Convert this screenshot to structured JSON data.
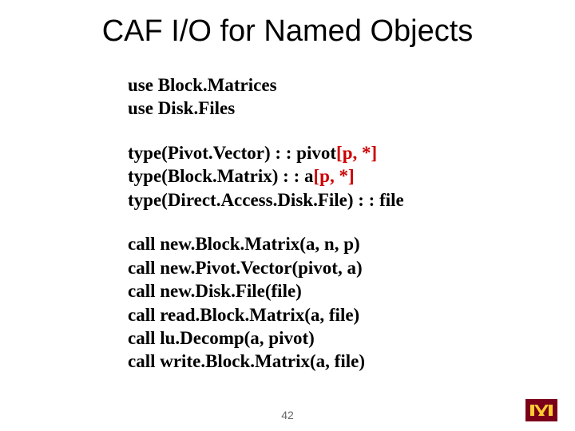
{
  "title": "CAF I/O for Named Objects",
  "slide_number": "42",
  "logo": {
    "bg": "#7a0019",
    "fg": "#ffcc33"
  },
  "block1": {
    "l1": "use Block.Matrices",
    "l2": "use Disk.Files"
  },
  "block2": {
    "l1a": "type(Pivot.Vector)  : : pivot",
    "l1b": "[p, *]",
    "l2a": "type(Block.Matrix) : : a",
    "l2b": "[p, *]",
    "l3": "type(Direct.Access.Disk.File) : : file"
  },
  "block3": {
    "l1": "call new.Block.Matrix(a, n, p)",
    "l2": "call new.Pivot.Vector(pivot, a)",
    "l3": "call new.Disk.File(file)",
    "l4": "call read.Block.Matrix(a, file)",
    "l5": "call lu.Decomp(a, pivot)",
    "l6": "call write.Block.Matrix(a, file)"
  }
}
